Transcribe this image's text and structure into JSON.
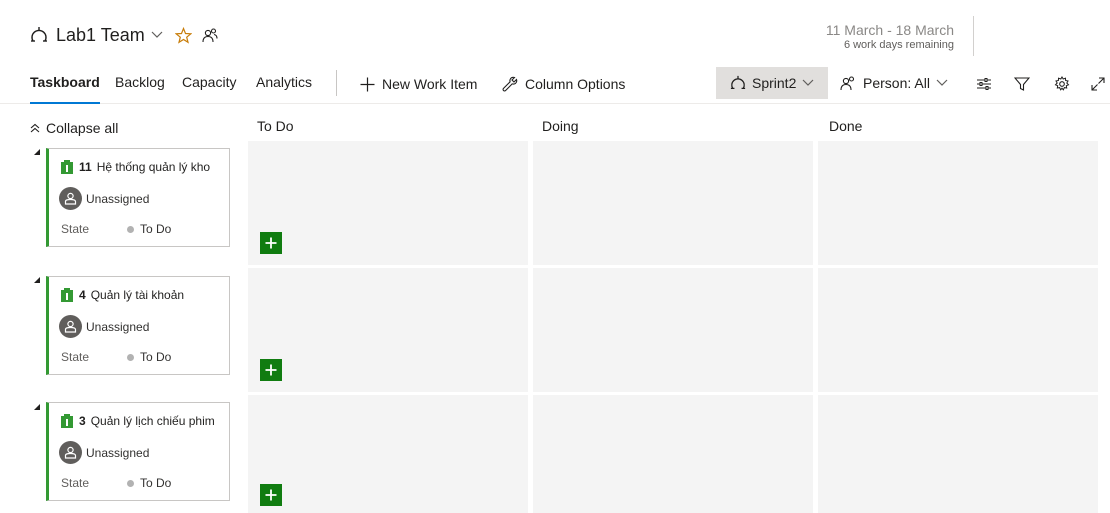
{
  "header": {
    "team_name": "Lab1 Team",
    "date_range": "11 March - 18 March",
    "days_remaining": "6 work days remaining"
  },
  "tabs": [
    {
      "label": "Taskboard",
      "active": true
    },
    {
      "label": "Backlog"
    },
    {
      "label": "Capacity"
    },
    {
      "label": "Analytics"
    }
  ],
  "toolbar": {
    "new_work_item": "New Work Item",
    "column_options": "Column Options",
    "sprint": "Sprint2",
    "person_filter": "Person: All"
  },
  "board": {
    "collapse_all": "Collapse all",
    "columns": [
      "To Do",
      "Doing",
      "Done"
    ],
    "rows": [
      {
        "id": "11",
        "title": "Hệ thống quản lý kho",
        "assignee": "Unassigned",
        "state_label": "State",
        "state": "To Do"
      },
      {
        "id": "4",
        "title": "Quản lý tài khoản",
        "assignee": "Unassigned",
        "state_label": "State",
        "state": "To Do"
      },
      {
        "id": "3",
        "title": "Quản lý lịch chiếu phim",
        "assignee": "Unassigned",
        "state_label": "State",
        "state": "To Do"
      }
    ]
  },
  "colors": {
    "accent": "#0078d4",
    "card_border": "#339933",
    "add_button": "#107c10",
    "cell_background": "#f4f4f4",
    "star": "#c87d0a"
  }
}
